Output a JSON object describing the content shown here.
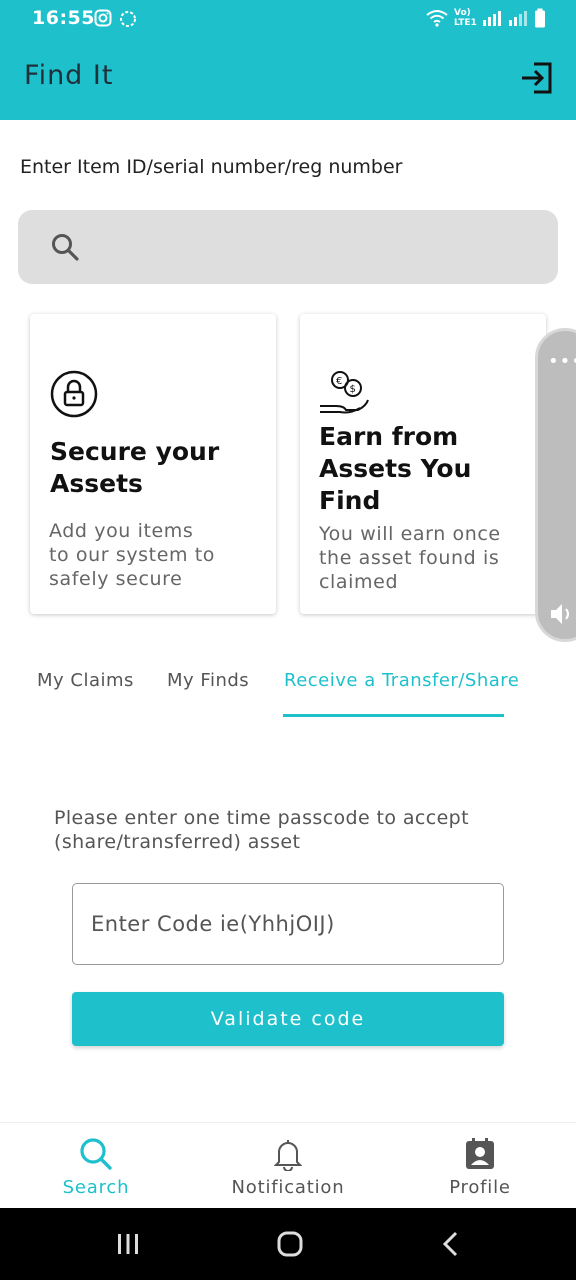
{
  "status_bar": {
    "time": "16:55",
    "network": "Vo) LTE1"
  },
  "app_bar": {
    "title": "Find It",
    "logout_icon": "logout-icon"
  },
  "search": {
    "prompt": "Enter Item ID/serial number/reg number",
    "placeholder": "",
    "icon": "search-icon"
  },
  "cards": [
    {
      "icon": "lock-icon",
      "heading": "Secure your Assets",
      "description_lines": [
        "Add you items",
        "to our system to",
        "safely secure"
      ]
    },
    {
      "icon": "money-hand-icon",
      "heading_lines": [
        "Earn from",
        "Assets You",
        "Find"
      ],
      "description_lines": [
        "You will earn once",
        "the asset found is",
        "claimed"
      ]
    }
  ],
  "tabs": [
    {
      "label": "My Claims",
      "active": false
    },
    {
      "label": "My Finds",
      "active": false
    },
    {
      "label": "Receive a Transfer/Share",
      "active": true
    }
  ],
  "transfer": {
    "instruction_lines": [
      "Please enter one time passcode to accept",
      "(share/transferred) asset"
    ],
    "code_placeholder": "Enter Code ie(YhhjOIJ)",
    "validate_label": "Validate code"
  },
  "bottom_nav": [
    {
      "label": "Search",
      "icon": "search-icon",
      "active": true
    },
    {
      "label": "Notification",
      "icon": "bell-icon",
      "active": false
    },
    {
      "label": "Profile",
      "icon": "profile-icon",
      "active": false
    }
  ],
  "colors": {
    "accent": "#1ec0cc",
    "search_bg": "#dedede"
  }
}
